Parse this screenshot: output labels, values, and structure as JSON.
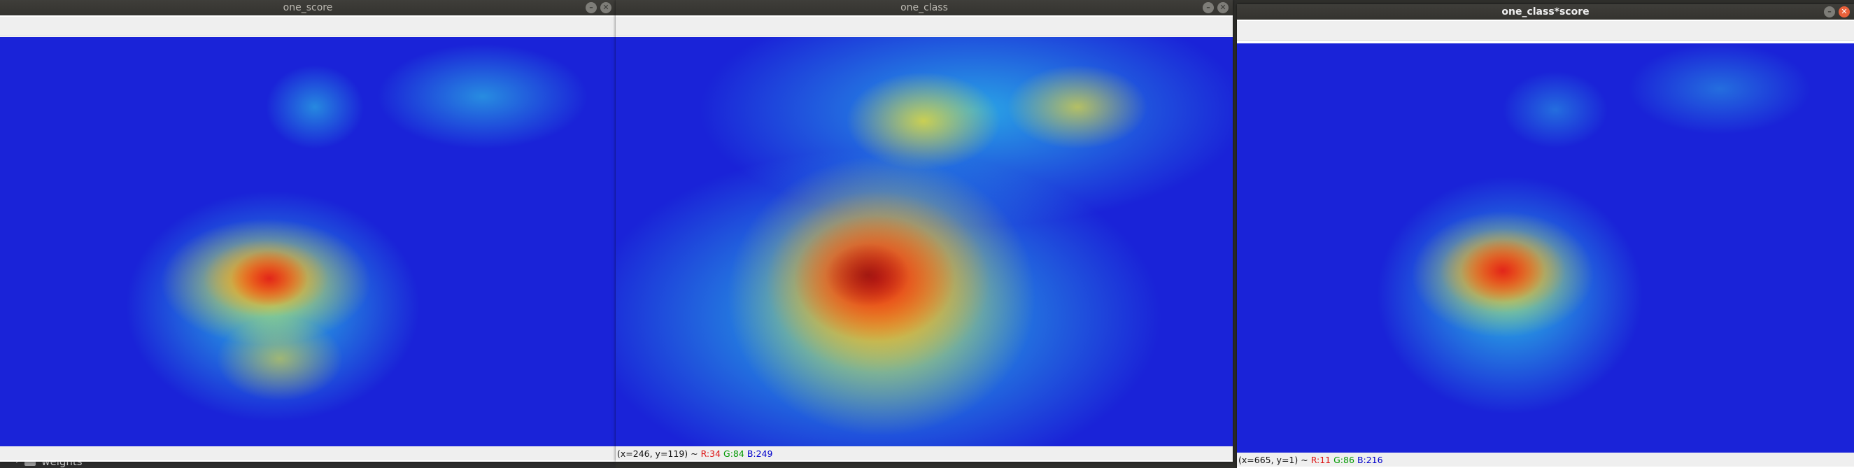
{
  "background": {
    "tree_item": "weights"
  },
  "windows": [
    {
      "title": "one_score",
      "status": {
        "coords": "",
        "r": "",
        "g": "",
        "b": ""
      }
    },
    {
      "title": "one_class",
      "status": {
        "coords": "(x=246, y=119) ~",
        "r": "R:34",
        "g": "G:84",
        "b": "B:249"
      }
    },
    {
      "title": "one_class*score",
      "status": {
        "coords": "(x=665, y=1) ~",
        "r": "R:11",
        "g": "G:86",
        "b": "B:216"
      }
    }
  ],
  "colors": {
    "heatmap_base": "#1a23d8",
    "hot": "#e0201a",
    "warm": "#ff8c10",
    "yellow": "#f2e030",
    "cyan": "#30e6e8",
    "close_active": "#e9603a"
  }
}
